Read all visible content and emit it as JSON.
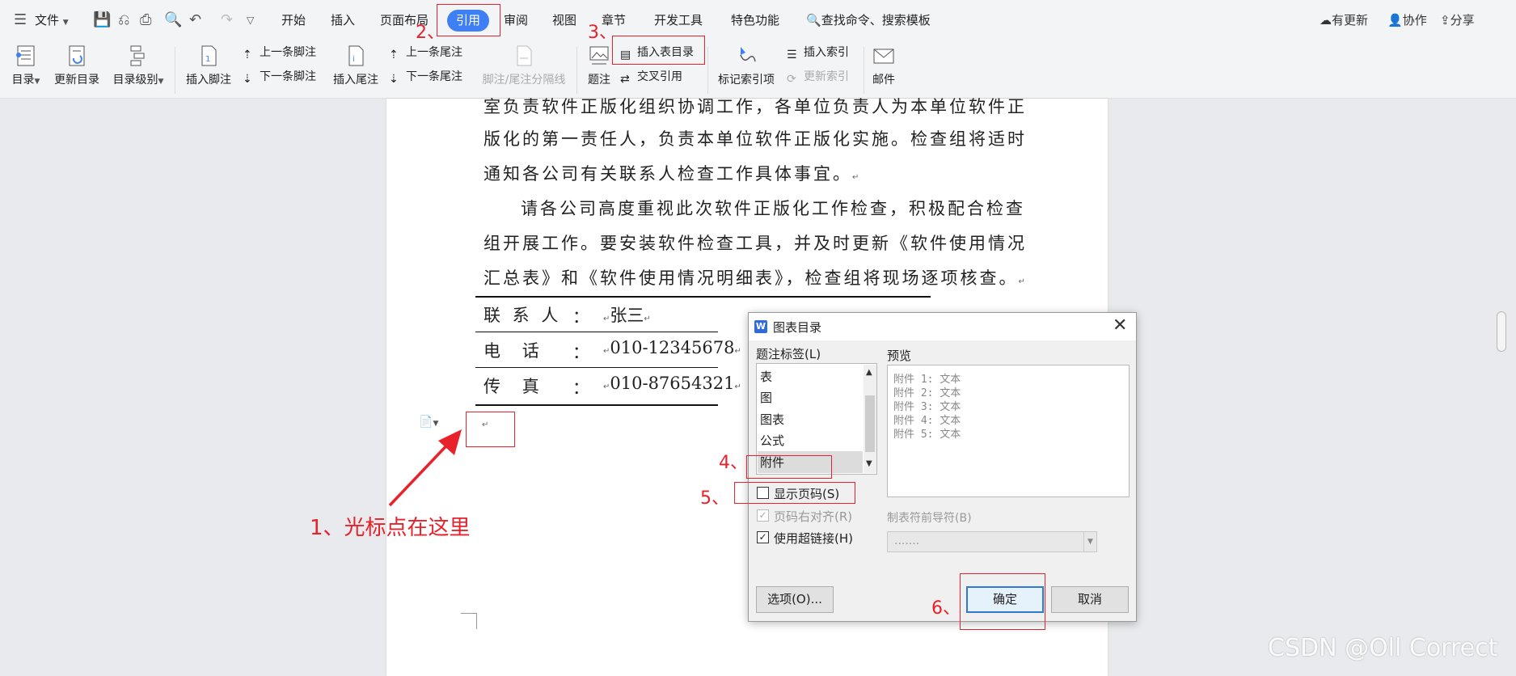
{
  "menubar": {
    "file": "文件",
    "tabs": [
      "开始",
      "插入",
      "页面布局",
      "引用",
      "审阅",
      "视图",
      "章节",
      "开发工具",
      "特色功能"
    ],
    "search": "查找命令、搜索模板",
    "right": [
      "有更新",
      "协作",
      "分享"
    ]
  },
  "ribbon": {
    "toc": "目录",
    "update_toc": "更新目录",
    "toc_level": "目录级别",
    "insert_footnote": "插入脚注",
    "prev_footnote": "上一条脚注",
    "next_footnote": "下一条脚注",
    "insert_endnote": "插入尾注",
    "prev_endnote": "上一条尾注",
    "next_endnote": "下一条尾注",
    "separator": "脚注/尾注分隔线",
    "caption": "题注",
    "insert_table_of_figures": "插入表目录",
    "cross_ref": "交叉引用",
    "mark_index": "标记索引项",
    "insert_index": "插入索引",
    "update_index": "更新索引",
    "mail": "邮件"
  },
  "document": {
    "lines": [
      "室负责软件正版化组织协调工作，各单位负责人为本单位软件正",
      "版化的第一责任人，负责本单位软件正版化实施。检查组将适时",
      "通知各公司有关联系人检查工作具体事宜。",
      "请各公司高度重视此次软件正版化工作检查，积极配合检查",
      "组开展工作。要安装软件检查工具，并及时更新《软件使用情况",
      "汇总表》和《软件使用情况明细表》，检查组将现场逐项核查。"
    ],
    "contacts": [
      {
        "label": "联 系 人",
        "sep": "：",
        "value": "张三"
      },
      {
        "label": "电    话",
        "sep": "：",
        "value": "010-12345678"
      },
      {
        "label": "传    真",
        "sep": "：",
        "value": "010-87654321"
      }
    ],
    "para_mark": "↵"
  },
  "dialog": {
    "title": "图表目录",
    "caption_label": "题注标签(L)",
    "caption_items": [
      "表",
      "图",
      "图表",
      "公式",
      "附件"
    ],
    "selected_caption": "附件",
    "preview_label": "预览",
    "preview_lines": [
      "附件 1: 文本",
      "附件 2: 文本",
      "附件 3: 文本",
      "附件 4: 文本",
      "附件 5: 文本"
    ],
    "show_page_numbers": "显示页码(S)",
    "right_align": "页码右对齐(R)",
    "use_hyperlinks": "使用超链接(H)",
    "tab_leader_label": "制表符前导符(B)",
    "tab_leader_value": ".......",
    "options_btn": "选项(O)...",
    "ok_btn": "确定",
    "cancel_btn": "取消",
    "close": "✕",
    "check": "✓"
  },
  "annotations": {
    "n1": "1、光标点在这里",
    "n2": "2、",
    "n3": "3、",
    "n4": "4、",
    "n5": "5、",
    "n6": "6、"
  },
  "watermark": "CSDN @Oll Correct",
  "colors": {
    "accent": "#3f7ff5",
    "annotation": "#e8212a"
  }
}
